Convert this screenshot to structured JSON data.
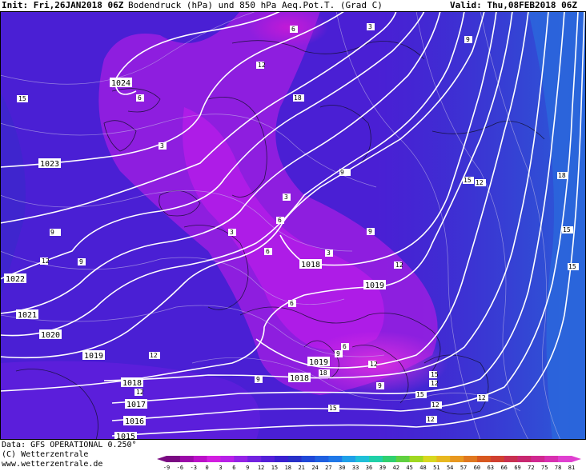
{
  "header": {
    "init": "Init: Fri,26JAN2018 06Z",
    "description": "Bodendruck (hPa) und 850 hPa Aeq.Pot.T. (Grad C)",
    "valid": "Valid: Thu,08FEB2018 06Z"
  },
  "footer": {
    "data_line": "Data: GFS OPERATIONAL 0.250°",
    "copyright": "(C) Wetterzentrale",
    "url": "www.wetterzentrale.de"
  },
  "isobars": [
    {
      "label": "1024"
    },
    {
      "label": "1023"
    },
    {
      "label": "1022"
    },
    {
      "label": "1021"
    },
    {
      "label": "1020"
    },
    {
      "label": "1019"
    },
    {
      "label": "1018"
    },
    {
      "label": "1018"
    },
    {
      "label": "1019"
    },
    {
      "label": "1018"
    },
    {
      "label": "1019"
    },
    {
      "label": "1017"
    },
    {
      "label": "1016"
    },
    {
      "label": "1015"
    }
  ],
  "theta_labels": [
    "6",
    "3",
    "9",
    "15",
    "6",
    "18",
    "12",
    "3",
    "9",
    "3",
    "6",
    "3",
    "6",
    "9",
    "3",
    "15",
    "12",
    "9",
    "12",
    "18",
    "15",
    "9",
    "12",
    "6",
    "6",
    "9",
    "18",
    "12",
    "12",
    "15",
    "12",
    "9",
    "12",
    "9",
    "15",
    "12",
    "15",
    "12",
    "12",
    "15"
  ],
  "colorbar": {
    "ticks": [
      "-9",
      "-6",
      "-3",
      "0",
      "3",
      "6",
      "9",
      "12",
      "15",
      "18",
      "21",
      "24",
      "27",
      "30",
      "33",
      "36",
      "39",
      "42",
      "45",
      "48",
      "51",
      "54",
      "57",
      "60",
      "63",
      "66",
      "69",
      "72",
      "75",
      "78",
      "81"
    ],
    "colors": [
      "#7a0a82",
      "#9b0aa8",
      "#bb10c8",
      "#d21ee0",
      "#b820e8",
      "#9422e6",
      "#7222e0",
      "#5420d8",
      "#3a20d0",
      "#2830c8",
      "#2048d8",
      "#2060e0",
      "#2078e8",
      "#20a0e8",
      "#20c0d8",
      "#20d0a8",
      "#30d070",
      "#60d040",
      "#a0d820",
      "#d8d820",
      "#e8b820",
      "#e89820",
      "#e07820",
      "#d85820",
      "#d04030",
      "#c83050",
      "#c82870",
      "#d02890",
      "#d830b0",
      "#e040d0"
    ]
  }
}
